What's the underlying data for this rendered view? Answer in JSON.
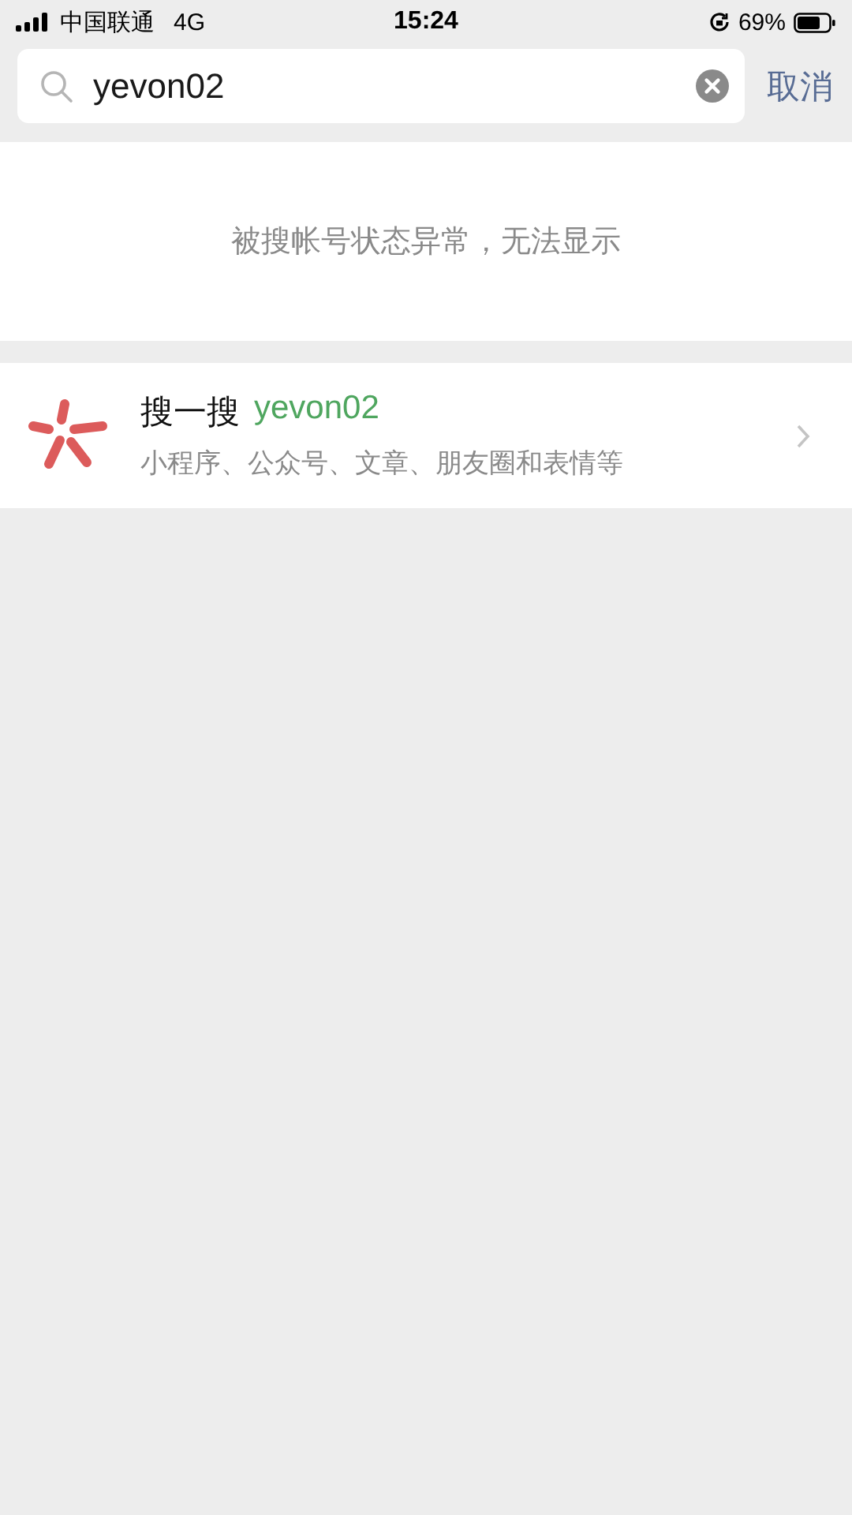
{
  "status_bar": {
    "carrier": "中国联通",
    "network": "4G",
    "time": "15:24",
    "battery": "69%"
  },
  "search": {
    "value": "yevon02",
    "cancel": "取消"
  },
  "notice": "被搜帐号状态异常，无法显示",
  "result": {
    "title": "搜一搜",
    "query": "yevon02",
    "subtitle": "小程序、公众号、文章、朋友圈和表情等"
  }
}
